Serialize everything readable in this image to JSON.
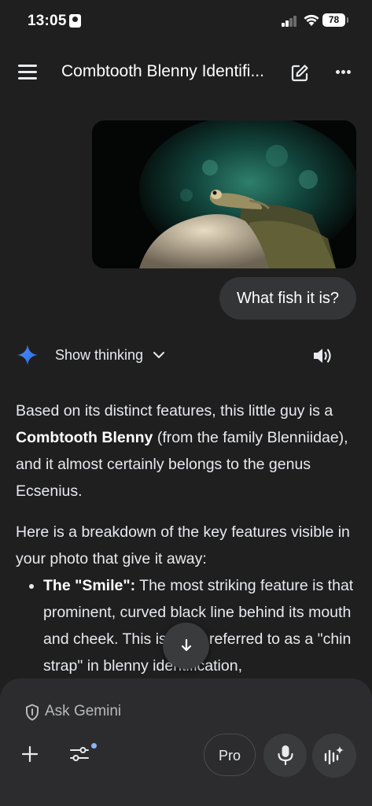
{
  "status_bar": {
    "time": "13:05",
    "battery": "78"
  },
  "header": {
    "title": "Combtooth Blenny Identifi..."
  },
  "chat": {
    "user_message": "What fish it is?",
    "show_thinking_label": "Show thinking",
    "response": {
      "p1_before": "Based on its distinct features, this little guy is a ",
      "p1_bold": "Combtooth Blenny",
      "p1_after": " (from the family Blenniidae), and it almost certainly belongs to the genus Ecsenius.",
      "p2": "Here is a breakdown of the key features visible in your photo that give it away:",
      "bullet1_bold": "The \"Smile\":",
      "bullet1_text": " The most striking feature is that prominent, curved black line behind its mouth and cheek. This is often referred to as a \"chin strap\" in blenny identification,"
    }
  },
  "composer": {
    "placeholder": "Ask Gemini",
    "pro_label": "Pro"
  },
  "colors": {
    "background": "#1f1f20",
    "accent": "#4f8df7",
    "bubble": "#333537"
  }
}
